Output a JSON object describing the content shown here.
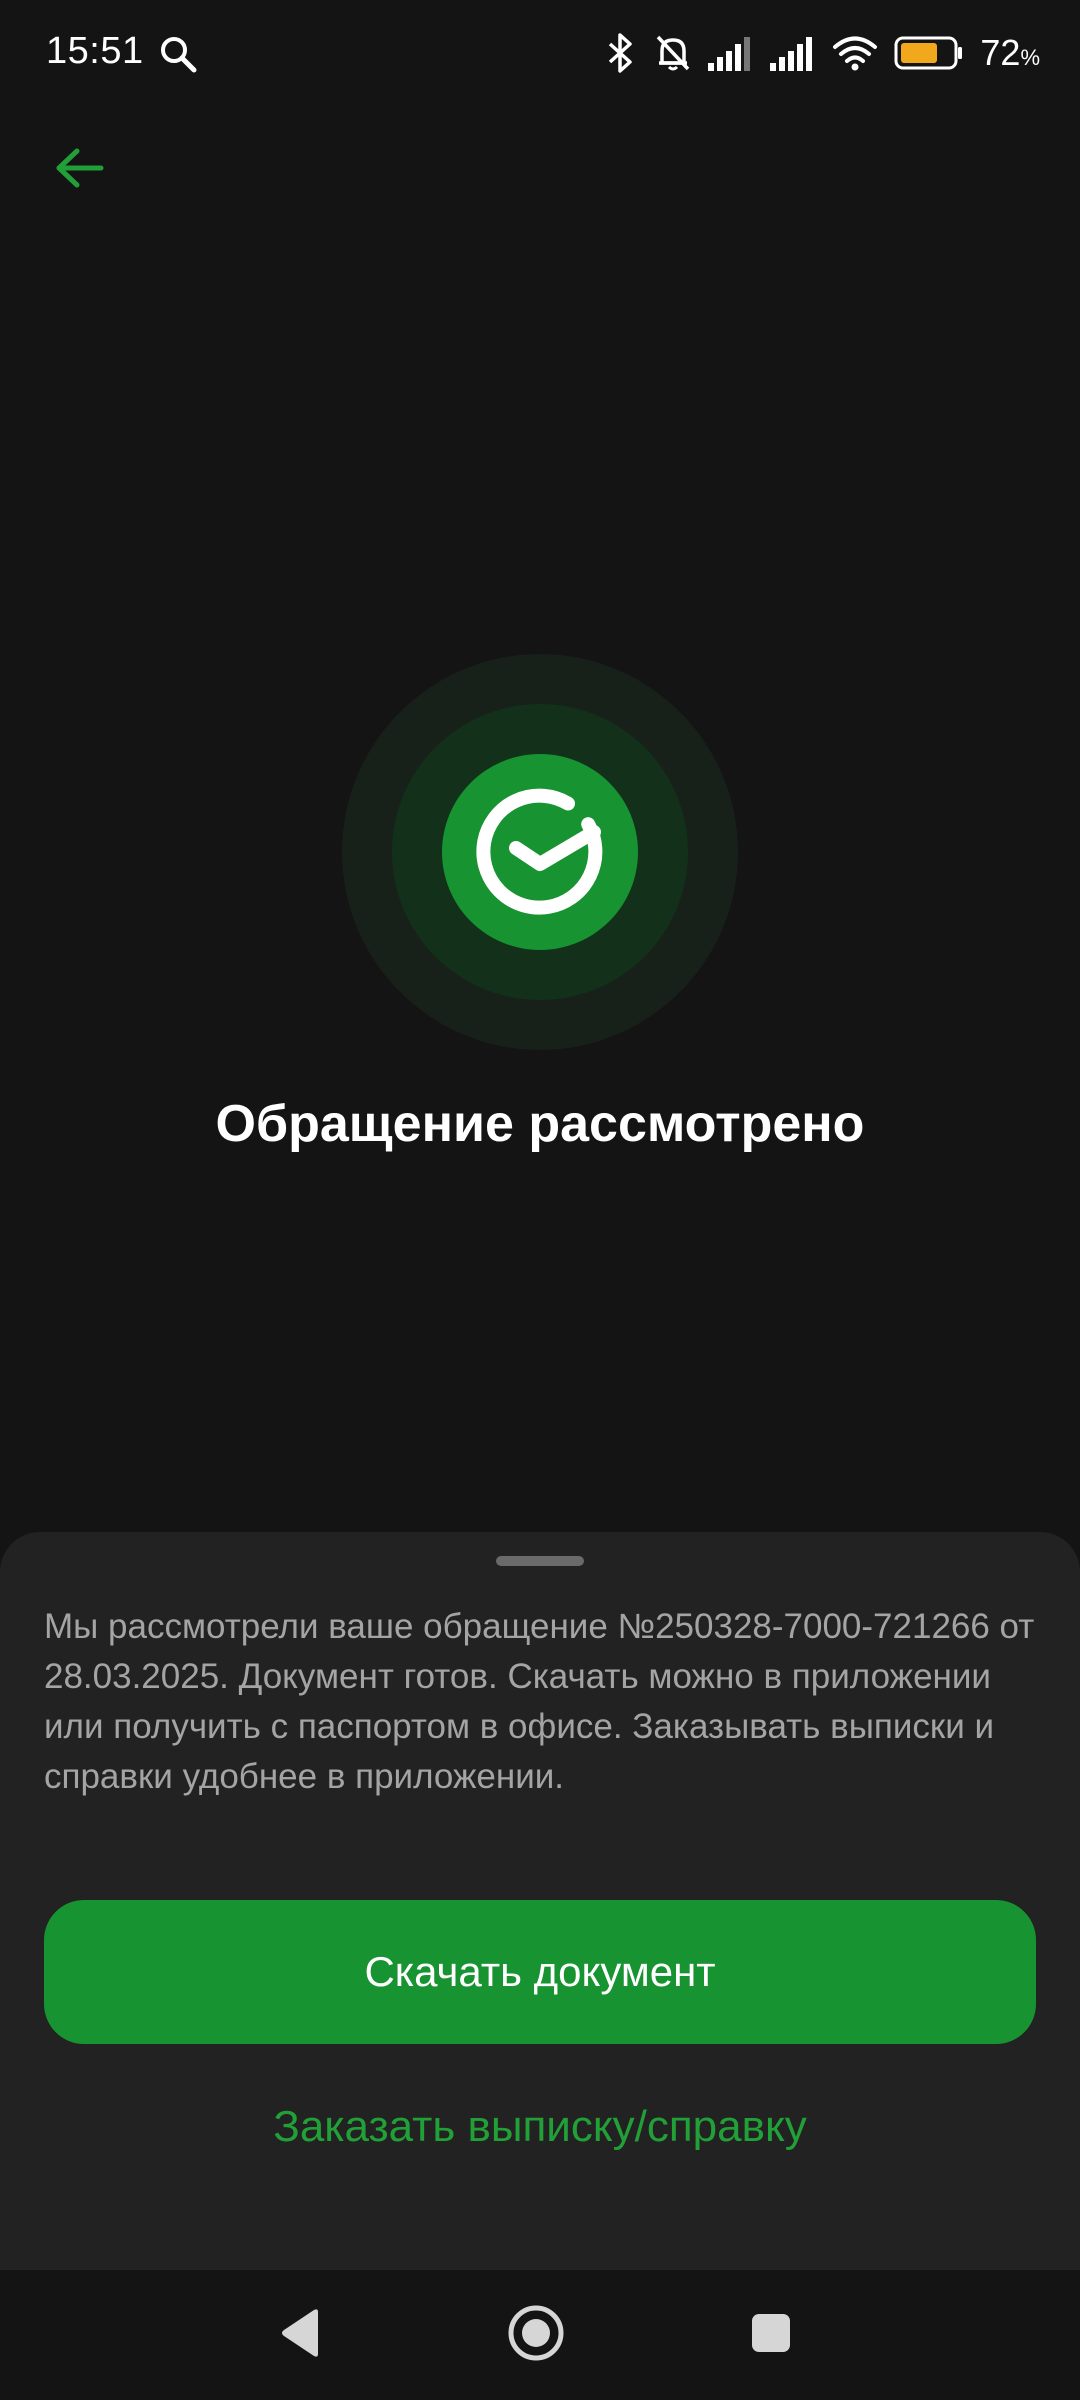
{
  "status_bar": {
    "time": "15:51",
    "battery_percent": "72",
    "battery_unit": "%",
    "battery_level": 0.72,
    "icons": [
      "search-icon",
      "bluetooth-icon",
      "bell-off-icon",
      "signal-icon",
      "signal-icon",
      "wifi-icon",
      "battery-icon"
    ]
  },
  "header": {
    "back_icon": "arrow-left-icon"
  },
  "result": {
    "icon": "sber-check-icon",
    "title": "Обращение рассмотрено"
  },
  "sheet": {
    "message": "Мы рассмотрели ваше обращение №250328-7000-721266 от 28.03.2025. Документ готов. Скачать можно в приложении или получить с паспортом в офисе. Заказывать выписки и справки удобнее в приложении.",
    "primary_button": "Скачать документ",
    "secondary_button": "Заказать выписку/справку"
  },
  "nav_bar": {
    "icons": [
      "back-triangle-icon",
      "home-circle-icon",
      "recents-square-icon"
    ]
  },
  "colors": {
    "accent": "#189331",
    "link": "#21a038",
    "background": "#141414",
    "sheet": "#222222",
    "battery": "#f2a81d"
  }
}
